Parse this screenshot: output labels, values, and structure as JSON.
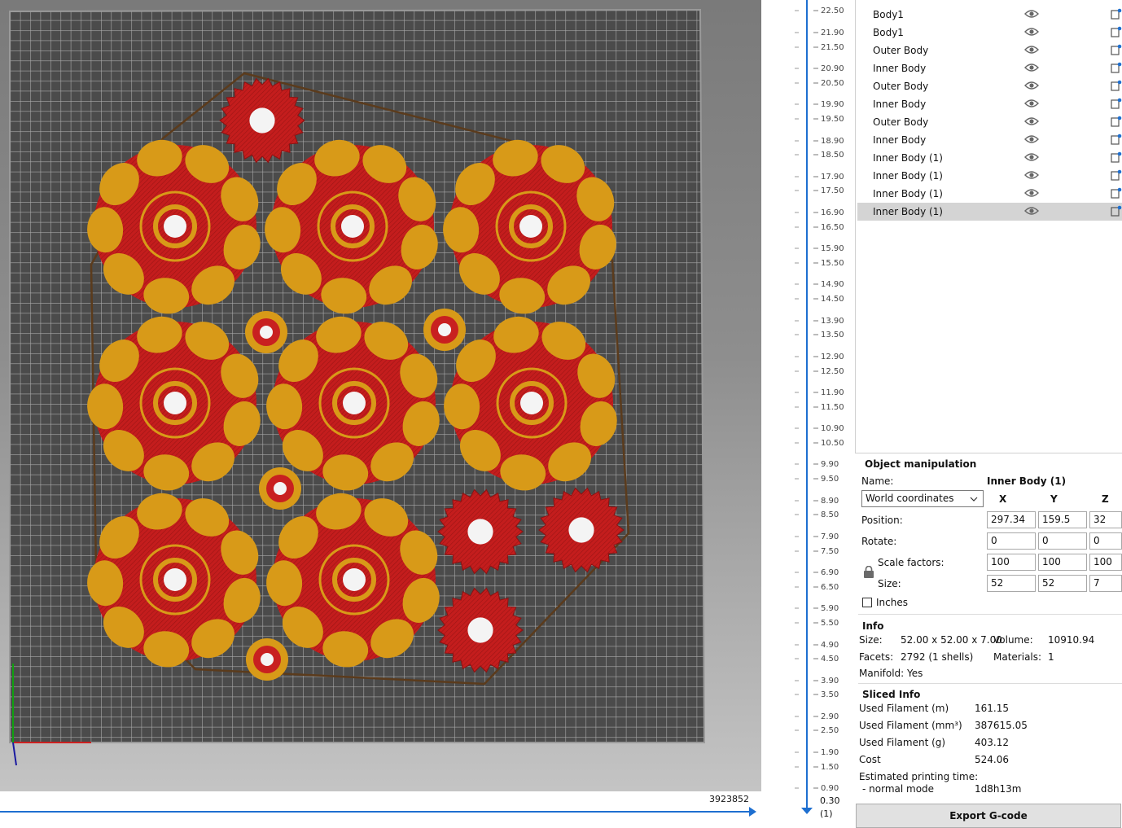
{
  "viewport": {
    "counter": "3923852"
  },
  "layer_slider": {
    "ticks": [
      "22.50",
      "21.90",
      "21.50",
      "20.90",
      "20.50",
      "19.90",
      "19.50",
      "18.90",
      "18.50",
      "17.90",
      "17.50",
      "16.90",
      "16.50",
      "15.90",
      "15.50",
      "14.90",
      "14.50",
      "13.90",
      "13.50",
      "12.90",
      "12.50",
      "11.90",
      "11.50",
      "10.90",
      "10.50",
      "9.90",
      "9.50",
      "8.90",
      "8.50",
      "7.90",
      "7.50",
      "6.90",
      "6.50",
      "5.90",
      "5.50",
      "4.90",
      "4.50",
      "3.90",
      "3.50",
      "2.90",
      "2.50",
      "1.90",
      "1.50",
      "0.90"
    ],
    "bottom_value": "0.30",
    "bottom_index": "(1)"
  },
  "object_list": {
    "items": [
      "Body1",
      "Body1",
      "Outer Body",
      "Inner Body",
      "Outer Body",
      "Inner Body",
      "Outer Body",
      "Inner Body",
      "Inner Body (1)",
      "Inner Body (1)",
      "Inner Body (1)",
      "Inner Body (1)"
    ],
    "selected_index": 11
  },
  "object_manipulation": {
    "title": "Object manipulation",
    "name_label": "Name:",
    "name_value": "Inner Body (1)",
    "coordinates": "World coordinates",
    "axis_x": "X",
    "axis_y": "Y",
    "axis_z": "Z",
    "position_label": "Position:",
    "position": [
      "297.34",
      "159.5",
      "32"
    ],
    "rotate_label": "Rotate:",
    "rotate": [
      "0",
      "0",
      "0"
    ],
    "scale_label": "Scale factors:",
    "scale": [
      "100",
      "100",
      "100"
    ],
    "size_label": "Size:",
    "size": [
      "52",
      "52",
      "7"
    ],
    "inches_label": "Inches"
  },
  "info": {
    "title": "Info",
    "size_label": "Size:",
    "size_value": "52.00 x 52.00 x 7.00",
    "volume_label": "Volume:",
    "volume_value": "10910.94",
    "facets_label": "Facets:",
    "facets_value": "2792 (1 shells)",
    "materials_label": "Materials:",
    "materials_value": "1",
    "manifold": "Manifold: Yes"
  },
  "sliced_info": {
    "title": "Sliced Info",
    "rows": [
      {
        "label": "Used Filament (m)",
        "value": "161.15"
      },
      {
        "label": "Used Filament (mm³)",
        "value": "387615.05"
      },
      {
        "label": "Used Filament (g)",
        "value": "403.12"
      },
      {
        "label": "Cost",
        "value": "524.06"
      }
    ],
    "time_label": "Estimated printing time:",
    "mode_label": "- normal mode",
    "mode_value": "1d8h13m"
  },
  "export_button": "Export G-code",
  "colors": {
    "infill_red": "#c82020",
    "perimeter_gold": "#d89a18",
    "skirt": "#5a3a1a",
    "bed_dark": "#4a4a4a",
    "slider_blue": "#1e6fd0"
  }
}
